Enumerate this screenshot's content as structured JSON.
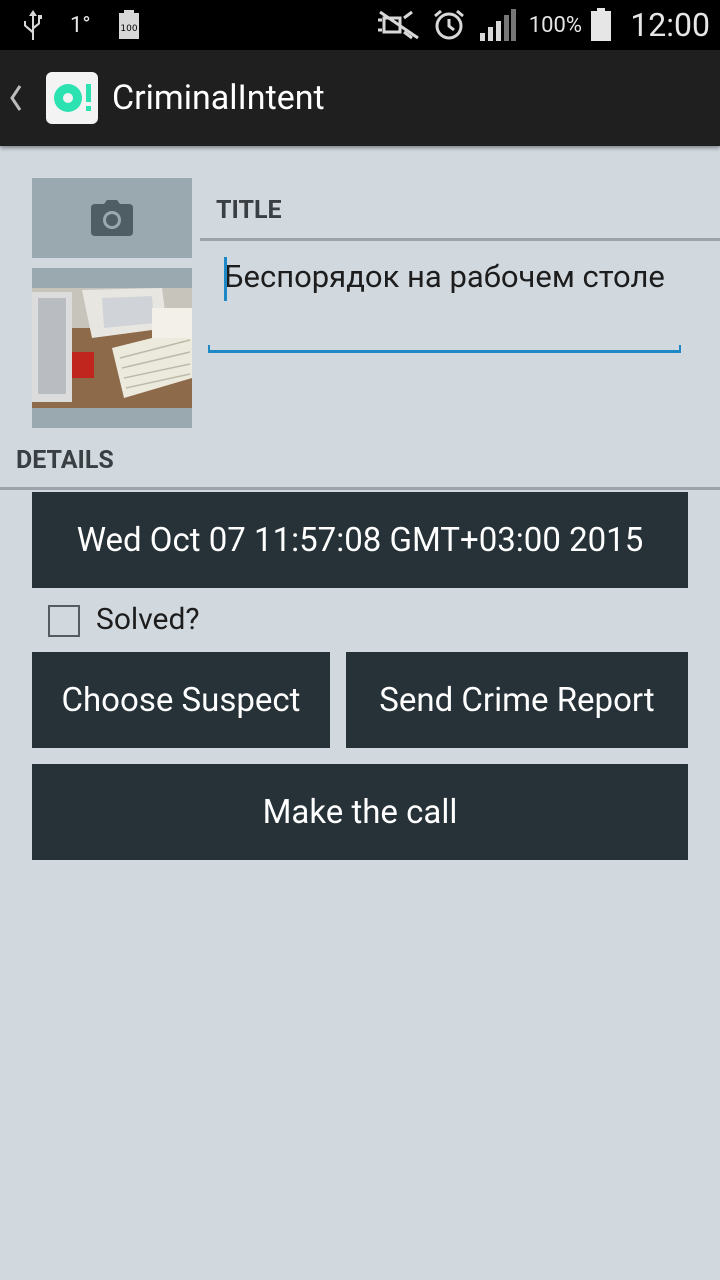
{
  "status_bar": {
    "time": "12:00",
    "battery_percent": "100%",
    "notification_badge": "1°",
    "battery_icon_text": "100",
    "icons": [
      "usb-icon",
      "notification-icon",
      "mini-battery-icon",
      "mute-icon",
      "alarm-icon",
      "signal-icon",
      "battery-icon"
    ]
  },
  "action_bar": {
    "title": "CriminalIntent",
    "up_icon": "chevron-left-icon",
    "app_icon": "criminal-intent-app-icon",
    "icon_color": "#2ce2b1"
  },
  "photo": {
    "camera_icon": "camera-icon",
    "thumbnail": "desk-photo"
  },
  "crime": {
    "title_header": "TITLE",
    "title_value": "Беспорядок на рабочем столе",
    "details_header": "DETAILS",
    "date_label": "Wed Oct 07 11:57:08 GMT+03:00 2015",
    "solved_label": "Solved?",
    "solved_checked": false
  },
  "actions": {
    "choose_suspect": "Choose Suspect",
    "send_report": "Send Crime Report",
    "make_call": "Make the call"
  },
  "colors": {
    "background": "#d1d9df",
    "button": "#263238",
    "accent": "#1e88c7",
    "photo_box": "#9aa8b0"
  }
}
